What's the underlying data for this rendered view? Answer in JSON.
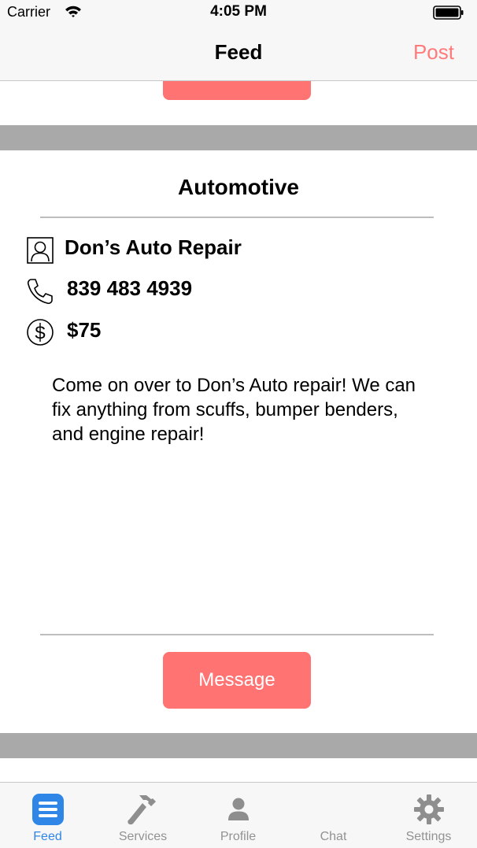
{
  "status_bar": {
    "carrier": "Carrier",
    "time": "4:05 PM",
    "wifi_icon": "wifi-icon",
    "battery_icon": "battery-icon"
  },
  "nav": {
    "title": "Feed",
    "post_label": "Post"
  },
  "card": {
    "category": "Automotive",
    "business_name": "Don’s Auto Repair",
    "phone": "839 483 4939",
    "price": "$75",
    "description": "Come on over to Don’s Auto repair! We can fix anything from scuffs, bumper benders, and engine repair!",
    "message_label": "Message",
    "icons": [
      "person-icon",
      "phone-icon",
      "dollar-icon"
    ]
  },
  "tabs": [
    {
      "label": "Feed",
      "icon": "feed-list-icon",
      "active": true
    },
    {
      "label": "Services",
      "icon": "hammer-icon",
      "active": false
    },
    {
      "label": "Profile",
      "icon": "person-icon",
      "active": false
    },
    {
      "label": "Chat",
      "icon": "chat-icon",
      "active": false
    },
    {
      "label": "Settings",
      "icon": "gear-icon",
      "active": false
    }
  ],
  "colors": {
    "accent": "#ff7373",
    "post_text": "#ff7b7b",
    "active_tab": "#2f86e6",
    "inactive_tab": "#929292",
    "separator": "#a9a9a9"
  }
}
